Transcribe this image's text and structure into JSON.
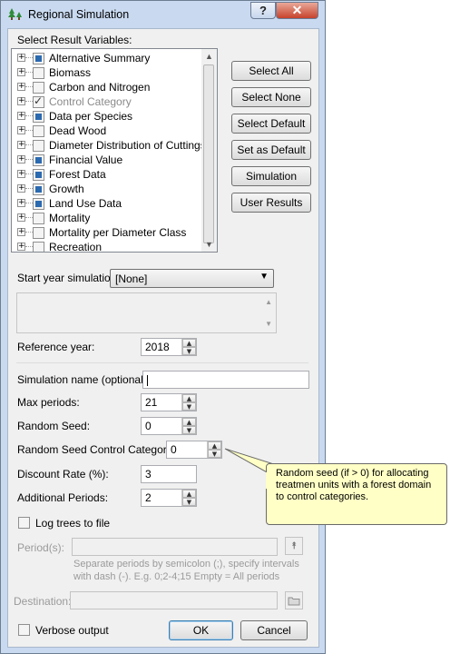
{
  "window": {
    "title": "Regional Simulation",
    "help_label": "?",
    "close_label": "✕",
    "app_icon": "tree-grid-icon"
  },
  "result_vars": {
    "label": "Select Result Variables:",
    "items": [
      {
        "label": "Alternative Summary",
        "state": "filled"
      },
      {
        "label": "Biomass",
        "state": "empty"
      },
      {
        "label": "Carbon and Nitrogen",
        "state": "empty"
      },
      {
        "label": "Control Category",
        "state": "checked-disabled"
      },
      {
        "label": "Data per Species",
        "state": "filled"
      },
      {
        "label": "Dead Wood",
        "state": "empty"
      },
      {
        "label": "Diameter Distribution of Cuttings",
        "state": "empty"
      },
      {
        "label": "Financial Value",
        "state": "filled"
      },
      {
        "label": "Forest Data",
        "state": "filled"
      },
      {
        "label": "Growth",
        "state": "filled"
      },
      {
        "label": "Land Use Data",
        "state": "filled"
      },
      {
        "label": "Mortality",
        "state": "empty"
      },
      {
        "label": "Mortality per Diameter Class",
        "state": "empty"
      },
      {
        "label": "Recreation",
        "state": "empty"
      }
    ]
  },
  "buttons": {
    "select_all": "Select All",
    "select_none": "Select None",
    "select_default": "Select Default",
    "set_as_default": "Set as Default",
    "simulation": "Simulation",
    "user_results": "User Results",
    "ok": "OK",
    "cancel": "Cancel"
  },
  "start_year": {
    "label": "Start year simulation:",
    "value": "[None]"
  },
  "reference_year": {
    "label": "Reference year:",
    "value": "2018"
  },
  "simulation_name": {
    "label": "Simulation name (optional):",
    "value": ""
  },
  "max_periods": {
    "label": "Max periods:",
    "value": "21"
  },
  "random_seed": {
    "label": "Random Seed:",
    "value": "0"
  },
  "random_seed_control": {
    "label": "Random Seed Control Categories:",
    "value": "0"
  },
  "discount_rate": {
    "label": "Discount Rate (%):",
    "value": "3"
  },
  "additional_periods": {
    "label": "Additional Periods:",
    "value": "2"
  },
  "log_trees": {
    "label": "Log trees to file"
  },
  "periods": {
    "label": "Period(s):",
    "hint_line1": "Separate periods by semicolon (;), specify intervals",
    "hint_line2": "with dash (-). E.g. 0;2-4;15    Empty = All periods"
  },
  "destination": {
    "label": "Destination:"
  },
  "verbose": {
    "label": "Verbose output"
  },
  "tooltip": {
    "text": "Random seed (if > 0) for allocating treatmen units with a forest domain to control categories."
  }
}
